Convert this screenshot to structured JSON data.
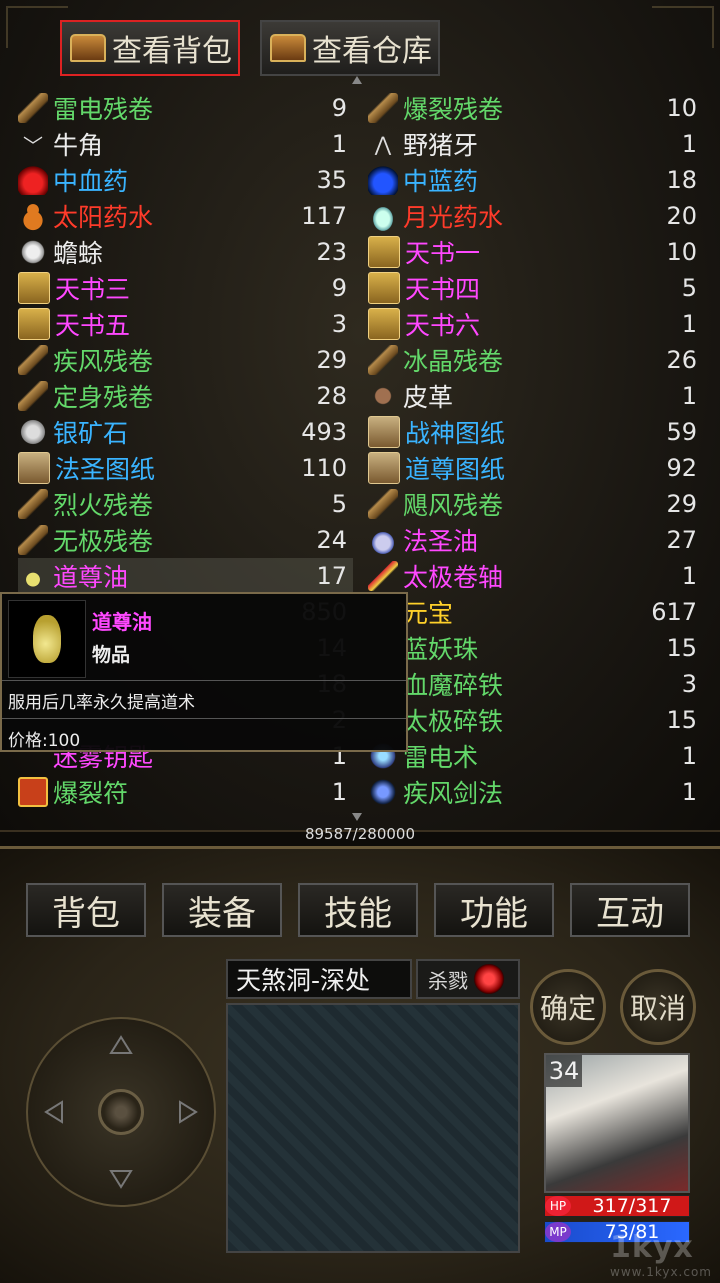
{
  "tabs": {
    "bag": "查看背包",
    "warehouse": "查看仓库"
  },
  "items": [
    {
      "name": "雷电残卷",
      "count": "9",
      "color": "g",
      "icon": "scroll"
    },
    {
      "name": "爆裂残卷",
      "count": "10",
      "color": "g",
      "icon": "scroll"
    },
    {
      "name": "牛角",
      "count": "1",
      "color": "w",
      "icon": "horn"
    },
    {
      "name": "野猪牙",
      "count": "1",
      "color": "w",
      "icon": "fang"
    },
    {
      "name": "中血药",
      "count": "35",
      "color": "b",
      "icon": "redpot"
    },
    {
      "name": "中蓝药",
      "count": "18",
      "color": "b",
      "icon": "bluepot"
    },
    {
      "name": "太阳药水",
      "count": "117",
      "color": "r",
      "icon": "gourd"
    },
    {
      "name": "月光药水",
      "count": "20",
      "color": "r",
      "icon": "vial"
    },
    {
      "name": "蟾蜍",
      "count": "23",
      "color": "w",
      "icon": "centipede"
    },
    {
      "name": "天书一",
      "count": "10",
      "color": "p",
      "icon": "book"
    },
    {
      "name": "天书三",
      "count": "9",
      "color": "p",
      "icon": "book"
    },
    {
      "name": "天书四",
      "count": "5",
      "color": "p",
      "icon": "book"
    },
    {
      "name": "天书五",
      "count": "3",
      "color": "p",
      "icon": "book"
    },
    {
      "name": "天书六",
      "count": "1",
      "color": "p",
      "icon": "book"
    },
    {
      "name": "疾风残卷",
      "count": "29",
      "color": "g",
      "icon": "scroll"
    },
    {
      "name": "冰晶残卷",
      "count": "26",
      "color": "g",
      "icon": "scroll"
    },
    {
      "name": "定身残卷",
      "count": "28",
      "color": "g",
      "icon": "scroll"
    },
    {
      "name": "皮革",
      "count": "1",
      "color": "w",
      "icon": "leather"
    },
    {
      "name": "银矿石",
      "count": "493",
      "color": "b",
      "icon": "ore"
    },
    {
      "name": "战神图纸",
      "count": "59",
      "color": "b",
      "icon": "drawing"
    },
    {
      "name": "法圣图纸",
      "count": "110",
      "color": "b",
      "icon": "drawing"
    },
    {
      "name": "道尊图纸",
      "count": "92",
      "color": "b",
      "icon": "drawing"
    },
    {
      "name": "烈火残卷",
      "count": "5",
      "color": "g",
      "icon": "scroll"
    },
    {
      "name": "飓风残卷",
      "count": "29",
      "color": "g",
      "icon": "scroll"
    },
    {
      "name": "无极残卷",
      "count": "24",
      "color": "g",
      "icon": "scroll"
    },
    {
      "name": "法圣油",
      "count": "27",
      "color": "p",
      "icon": "whiteoil"
    },
    {
      "name": "道尊油",
      "count": "17",
      "color": "p",
      "icon": "smalloil",
      "selected": true
    },
    {
      "name": "太极卷轴",
      "count": "1",
      "color": "p",
      "icon": "rod"
    },
    {
      "name": "",
      "count": "850",
      "color": "w",
      "icon": ""
    },
    {
      "name": "元宝",
      "count": "617",
      "color": "y",
      "icon": ""
    },
    {
      "name": "",
      "count": "14",
      "color": "w",
      "icon": ""
    },
    {
      "name": "蓝妖珠",
      "count": "15",
      "color": "g",
      "icon": ""
    },
    {
      "name": "",
      "count": "18",
      "color": "w",
      "icon": ""
    },
    {
      "name": "血魔碎铁",
      "count": "3",
      "color": "g",
      "icon": ""
    },
    {
      "name": "",
      "count": "2",
      "color": "w",
      "icon": ""
    },
    {
      "name": "太极碎铁",
      "count": "15",
      "color": "g",
      "icon": ""
    },
    {
      "name": "迷雾钥匙",
      "count": "1",
      "color": "p",
      "icon": ""
    },
    {
      "name": "雷电术",
      "count": "1",
      "color": "g",
      "icon": "spell1"
    },
    {
      "name": "爆裂符",
      "count": "1",
      "color": "g",
      "icon": "talisman"
    },
    {
      "name": "疾风剑法",
      "count": "1",
      "color": "g",
      "icon": "spell2"
    }
  ],
  "tooltip": {
    "name": "道尊油",
    "type": "物品",
    "desc": "服用后几率永久提高道术",
    "price": "价格:100"
  },
  "exp": "89587/280000",
  "menu": [
    "背包",
    "装备",
    "技能",
    "功能",
    "互动"
  ],
  "location": "天煞洞-深处",
  "kill_label": "杀戮",
  "confirm": "确定",
  "cancel": "取消",
  "player": {
    "level": "34",
    "hp": "317/317",
    "mp": "73/81",
    "hp_label": "HP",
    "mp_label": "MP"
  },
  "watermark": {
    "brand": "1kyx",
    "domain": "www.1kyx.com"
  }
}
